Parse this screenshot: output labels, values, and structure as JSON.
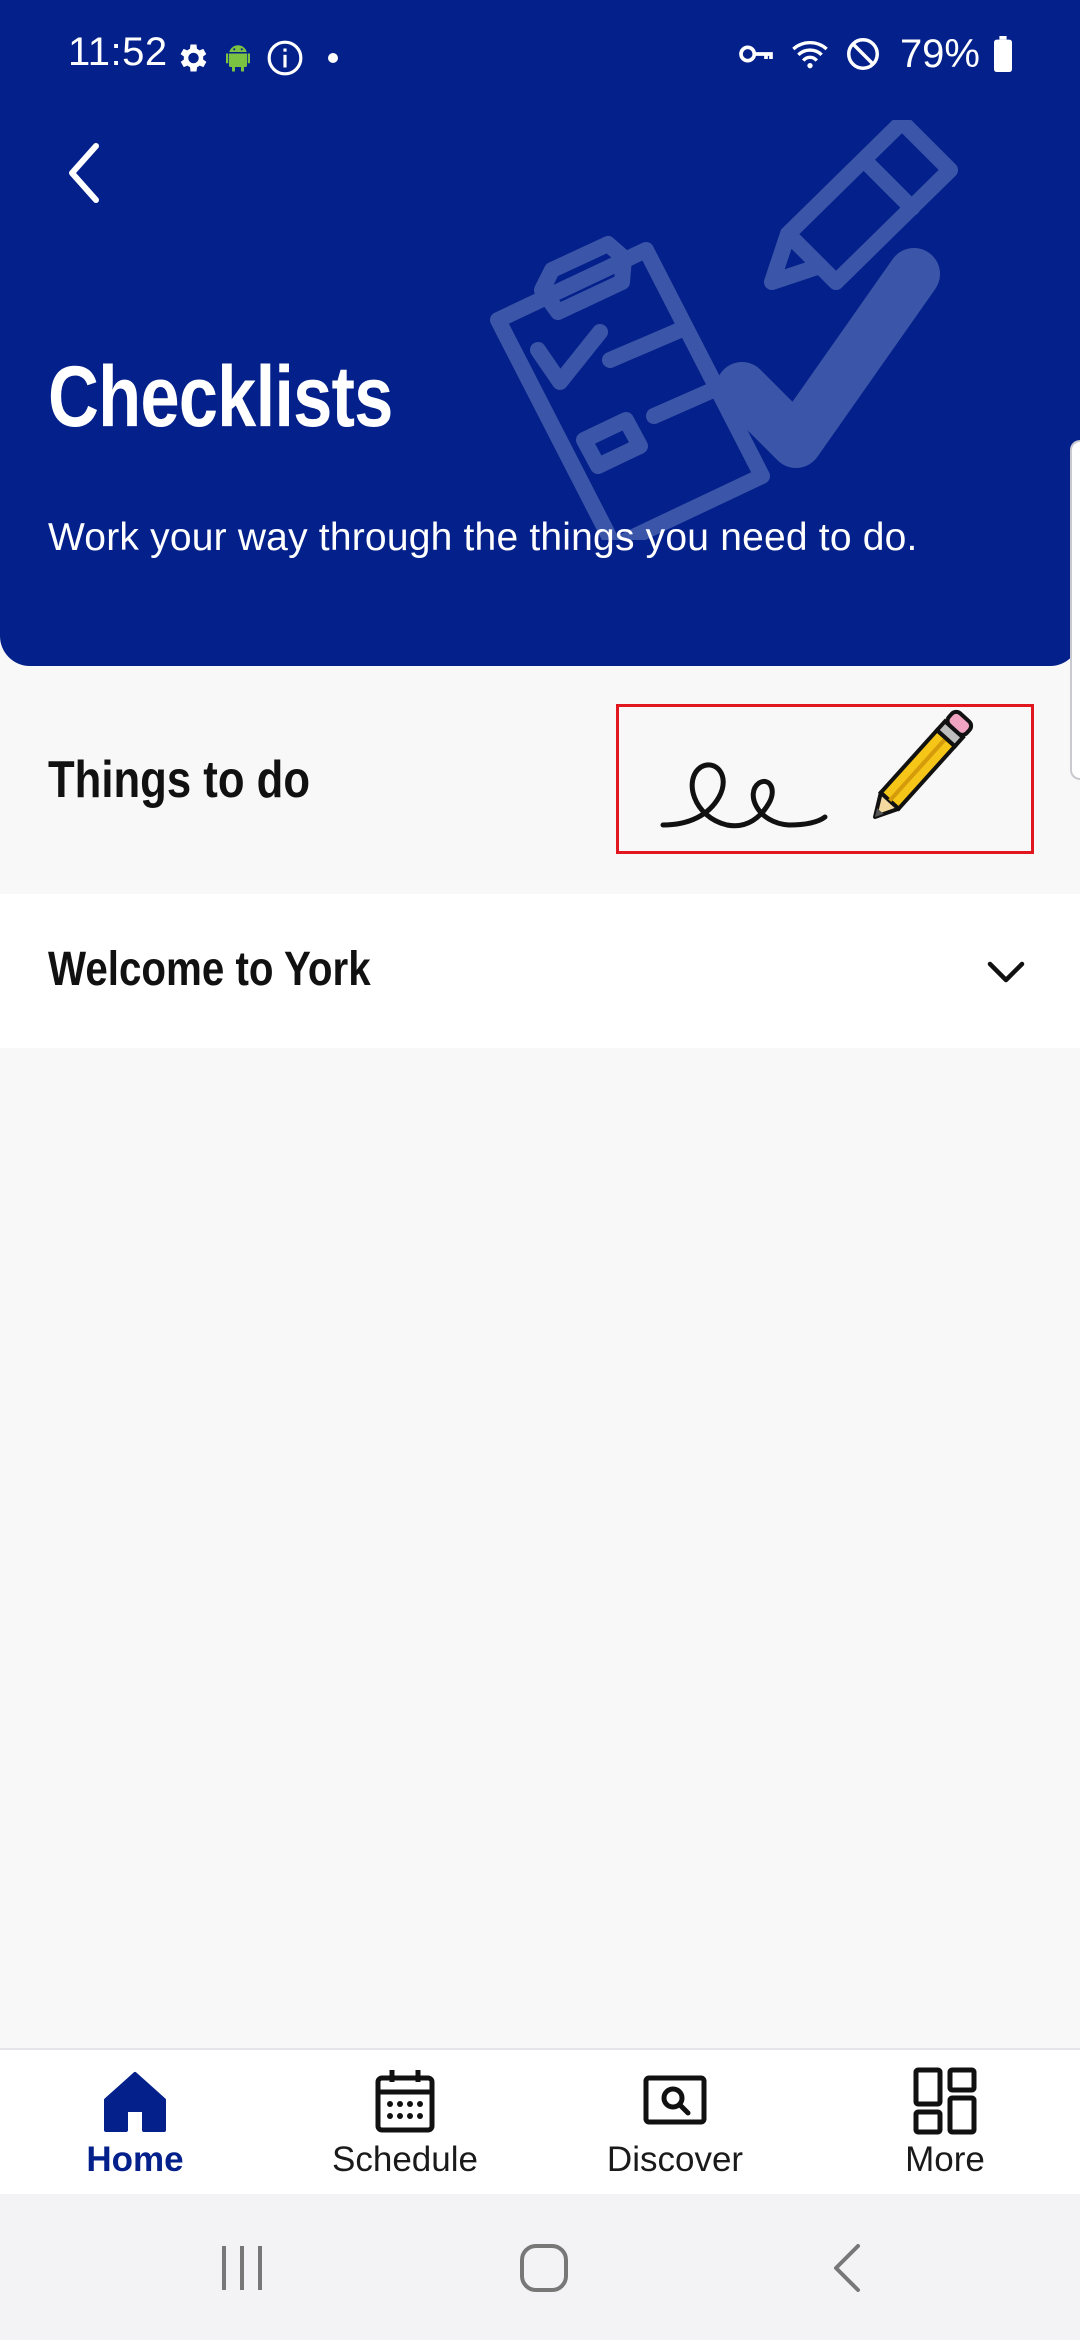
{
  "status_bar": {
    "time": "11:52",
    "battery": "79%",
    "icons_left": [
      "settings-icon",
      "android-icon",
      "info-icon",
      "dot-icon"
    ],
    "icons_right": [
      "vpn-key-icon",
      "wifi-icon",
      "do-not-disturb-icon",
      "battery-icon"
    ]
  },
  "header": {
    "title": "Checklists",
    "subtitle": "Work your way through the things you need to do.",
    "background_color": "#04208a"
  },
  "section": {
    "title": "Things to do",
    "highlight_color": "#e2161f"
  },
  "accordion": {
    "title": "Welcome to York"
  },
  "bottom_nav": {
    "items": [
      {
        "label": "Home",
        "icon": "home-icon",
        "active": true
      },
      {
        "label": "Schedule",
        "icon": "calendar-icon",
        "active": false
      },
      {
        "label": "Discover",
        "icon": "discover-icon",
        "active": false
      },
      {
        "label": "More",
        "icon": "grid-icon",
        "active": false
      }
    ],
    "active_color": "#04208a"
  },
  "system_nav": {
    "buttons": [
      "recents-icon",
      "home-circle-icon",
      "back-icon"
    ]
  }
}
